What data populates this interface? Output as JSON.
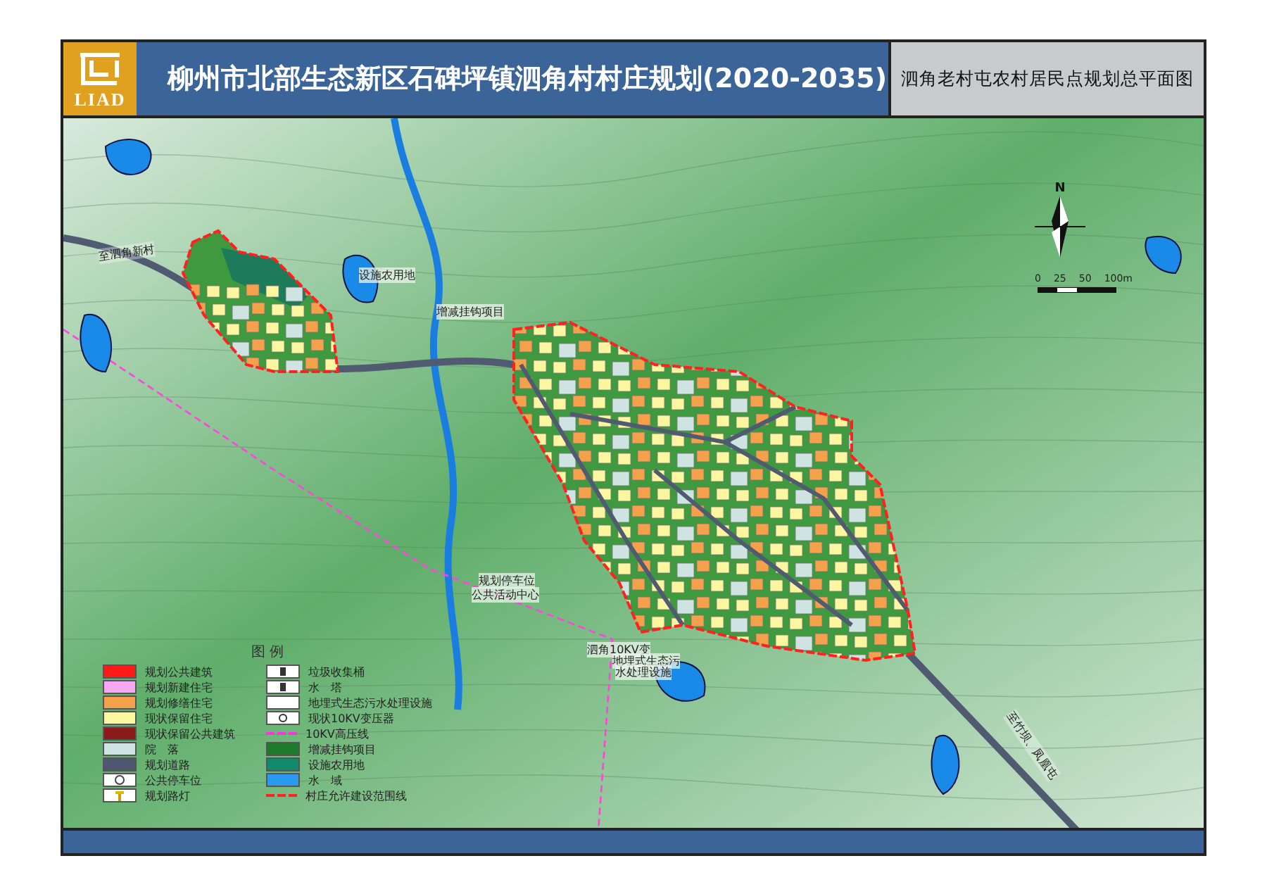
{
  "header": {
    "logo_text": "LIAD",
    "title": "柳州市北部生态新区石碑坪镇泗角村村庄规划(2020-2035)",
    "subtitle": "泗角老村屯农村居民点规划总平面图"
  },
  "map": {
    "labels": [
      {
        "text": "至泗角新村",
        "kind": "road"
      },
      {
        "text": "设施农用地",
        "kind": "place"
      },
      {
        "text": "增减挂钩项目",
        "kind": "place"
      },
      {
        "text": "规划停车位",
        "kind": "place"
      },
      {
        "text": "公共活动中心",
        "kind": "place"
      },
      {
        "text": "泗角10KV变",
        "kind": "place"
      },
      {
        "text": "地埋式生态污",
        "kind": "place"
      },
      {
        "text": "水处理设施",
        "kind": "place"
      },
      {
        "text": "至竹坝、凤凰屯",
        "kind": "road"
      }
    ],
    "north": "N",
    "scale": [
      "0",
      "25",
      "50",
      "100m"
    ]
  },
  "legend": {
    "title": "图 例",
    "columns": [
      [
        {
          "label": "规划公共建筑",
          "kind": "fill",
          "color": "#ff1a1a"
        },
        {
          "label": "规划新建住宅",
          "kind": "fill",
          "color": "#f7a6f0"
        },
        {
          "label": "规划修缮住宅",
          "kind": "fill",
          "color": "#f5a04a"
        },
        {
          "label": "现状保留住宅",
          "kind": "fill",
          "color": "#fdf6a0"
        },
        {
          "label": "现状保留公共建筑",
          "kind": "fill",
          "color": "#8b1a1a"
        },
        {
          "label": "院　落",
          "kind": "fill",
          "color": "#cfe3e3"
        },
        {
          "label": "规划道路",
          "kind": "fill",
          "color": "#4e5670"
        },
        {
          "label": "公共停车位",
          "kind": "parking"
        },
        {
          "label": "规划路灯",
          "kind": "lamp"
        }
      ],
      [
        {
          "label": "垃圾收集桶",
          "kind": "bin"
        },
        {
          "label": "水　塔",
          "kind": "bin"
        },
        {
          "label": "地埋式生态污水处理设施",
          "kind": "empty"
        },
        {
          "label": "现状10KV变压器",
          "kind": "dot"
        },
        {
          "label": "10KV高压线",
          "kind": "dash",
          "color": "#ff33dd"
        },
        {
          "label": "增减挂钩项目",
          "kind": "fill",
          "color": "#1d7a2a"
        },
        {
          "label": "设施农用地",
          "kind": "fill",
          "color": "#0f8a6a"
        },
        {
          "label": "水　域",
          "kind": "fill",
          "color": "#2a9af0"
        },
        {
          "label": "村庄允许建设范围线",
          "kind": "dash",
          "color": "#ff2222"
        }
      ]
    ]
  }
}
